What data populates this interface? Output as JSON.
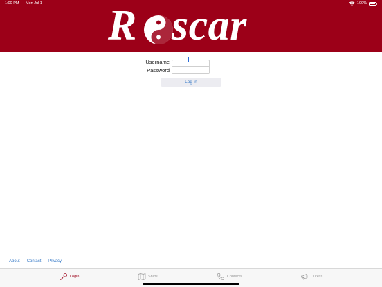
{
  "status_bar": {
    "time": "1:00 PM",
    "date": "Mon Jul 1",
    "battery": "100%"
  },
  "header": {
    "logo_text_first": "R",
    "logo_text_rest": "scar",
    "brand_color": "#9c0018"
  },
  "form": {
    "username_label": "Username",
    "username_value": "",
    "password_label": "Password",
    "password_value": "",
    "login_button": "Log in"
  },
  "footer_links": [
    "About",
    "Contact",
    "Privacy"
  ],
  "tabs": [
    {
      "label": "Login",
      "icon": "key-icon",
      "active": true
    },
    {
      "label": "Shifts",
      "icon": "map-icon",
      "active": false
    },
    {
      "label": "Contacts",
      "icon": "phone-icon",
      "active": false
    },
    {
      "label": "Duress",
      "icon": "megaphone-icon",
      "active": false
    }
  ],
  "colors": {
    "link": "#3478c6",
    "tab_inactive": "#9a9a9a",
    "tab_active": "#9c0018"
  }
}
